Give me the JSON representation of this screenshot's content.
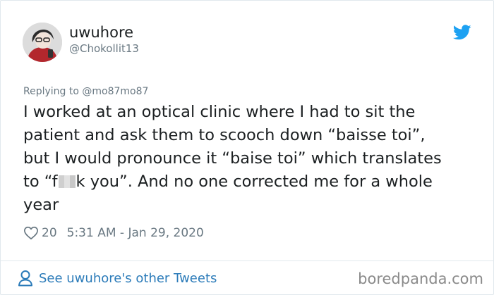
{
  "tweet": {
    "display_name": "uwuhore",
    "handle": "@Chokollit13",
    "reply_prefix": "Replying to",
    "reply_to": "@mo87mo87",
    "text_lines": [
      "I worked at an optical clinic where I had to sit the",
      "patient and ask them to scooch down “baisse toi”,",
      "but I would pronounce it “baise toi” which translates",
      "to “f"
    ],
    "text_after_censor": "k you”. And no one corrected me for a whole",
    "text_last_line": "year",
    "likes": "20",
    "timestamp": "5:31 AM - Jan 29, 2020"
  },
  "footer": {
    "see_more_label": "See uwuhore's other Tweets"
  },
  "watermark": "boredpanda.com",
  "colors": {
    "twitter_blue": "#1da1f2",
    "link_blue": "#2b7bb9",
    "muted": "#697882",
    "text": "#1c2022"
  },
  "icons": {
    "brand": "twitter-bird-icon",
    "like": "heart-icon",
    "profile": "user-icon"
  }
}
